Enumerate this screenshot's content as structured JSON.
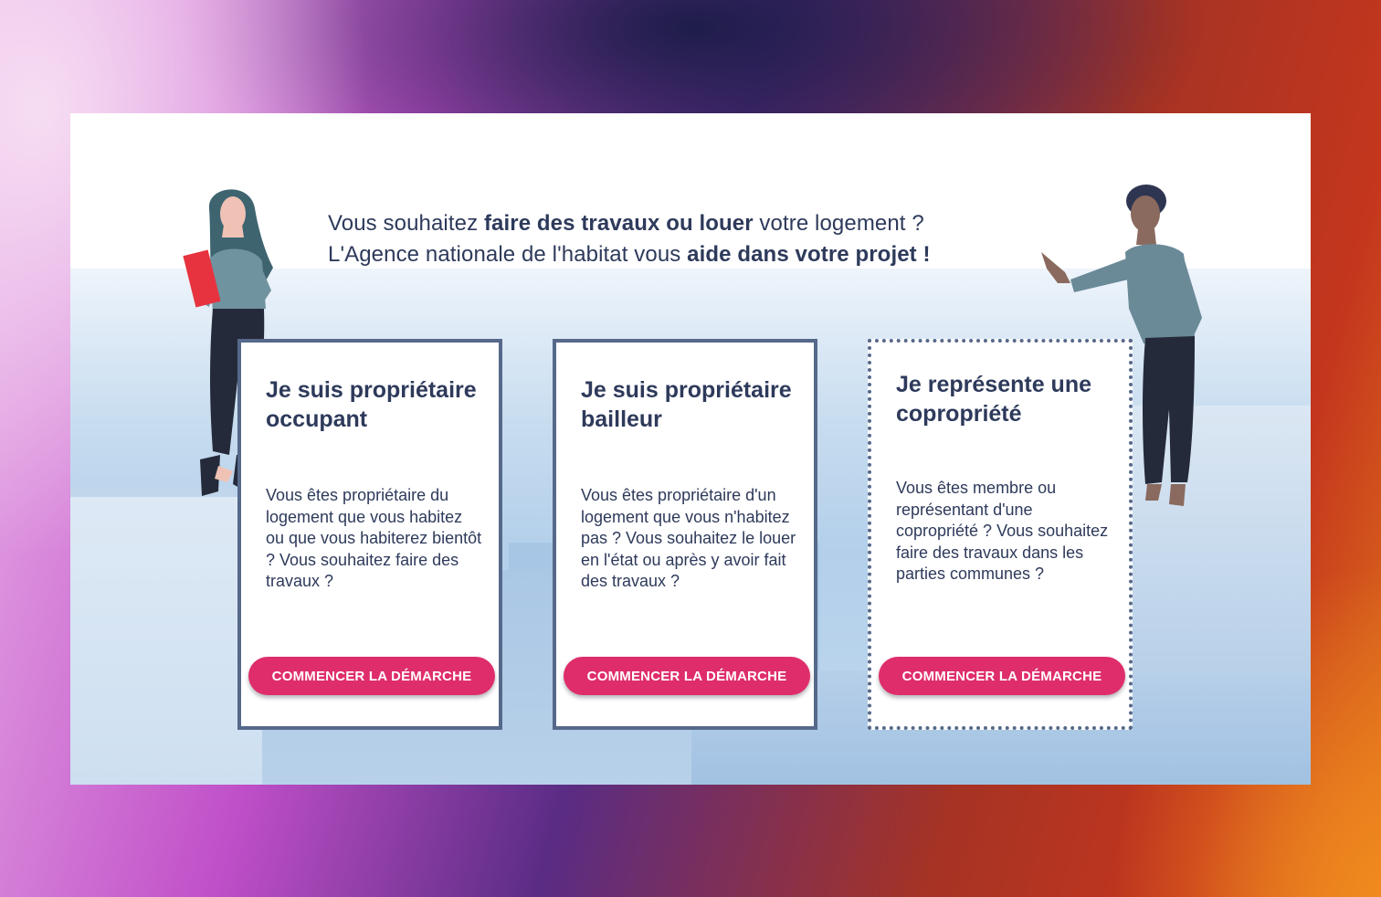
{
  "hero": {
    "line1_pre": "Vous souhaitez ",
    "line1_bold": "faire des travaux ou louer",
    "line1_post": " votre logement ?",
    "line2_pre": "L'Agence nationale de l'habitat vous ",
    "line2_bold": "aide dans votre projet !"
  },
  "cards": [
    {
      "title": "Je suis propriétaire occupant",
      "description": "Vous êtes propriétaire du logement que vous habitez ou que vous habiterez bientôt ? Vous souhaitez faire des travaux ?",
      "button_label": "COMMENCER LA DÉMARCHE"
    },
    {
      "title": "Je suis propriétaire bailleur",
      "description": "Vous êtes propriétaire d'un logement que vous n'habitez pas ? Vous souhaitez le louer en l'état ou après y avoir fait des travaux ?",
      "button_label": "COMMENCER LA DÉMARCHE"
    },
    {
      "title": "Je représente une copropriété",
      "description": "Vous êtes membre ou représentant d'une copropriété ? Vous souhaitez faire des travaux dans les parties communes ?",
      "button_label": "COMMENCER LA DÉMARCHE"
    }
  ],
  "illustrations": {
    "left": "woman-holding-folder-illustration",
    "right": "man-pointing-illustration"
  },
  "colors": {
    "primary_text": "#2e3a5b",
    "card_border": "#56698a",
    "button": "#df2d6b"
  }
}
